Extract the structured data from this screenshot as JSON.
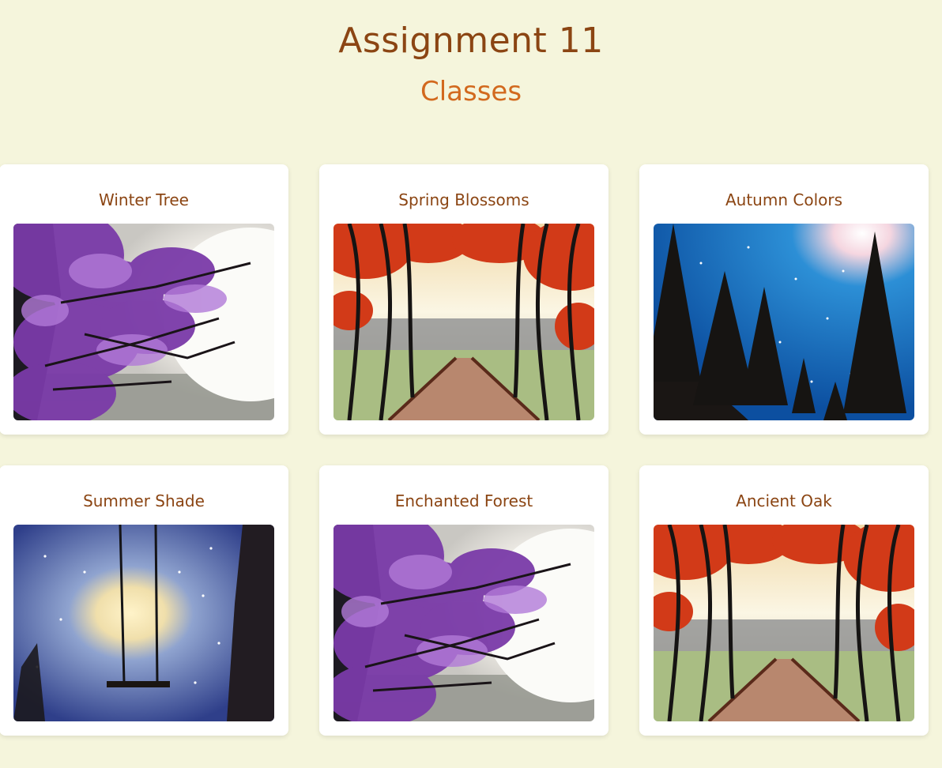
{
  "header": {
    "title": "Assignment 11",
    "subtitle": "Classes"
  },
  "colors": {
    "background": "#f5f5dc",
    "title": "#8b4513",
    "subtitle": "#d2691e",
    "card": "#ffffff"
  },
  "classes": [
    {
      "title": "Winter Tree",
      "image": "purple-tree-moon-painting"
    },
    {
      "title": "Spring Blossoms",
      "image": "red-tree-path-painting"
    },
    {
      "title": "Autumn Colors",
      "image": "pine-trees-night-painting"
    },
    {
      "title": "Summer Shade",
      "image": "swing-moon-painting"
    },
    {
      "title": "Enchanted Forest",
      "image": "purple-tree-moon-painting"
    },
    {
      "title": "Ancient Oak",
      "image": "red-tree-path-painting"
    }
  ]
}
